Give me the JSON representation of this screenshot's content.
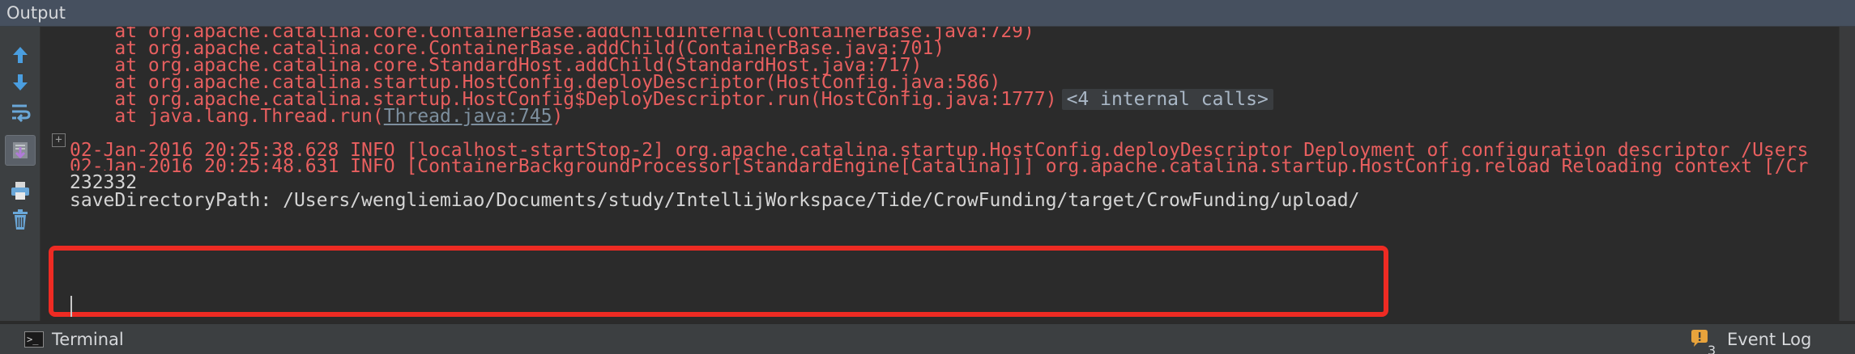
{
  "panel": {
    "title": "Output"
  },
  "console": {
    "lines": [
      {
        "kind": "err",
        "text": "    at org.apache.catalina.core.ContainerBase.addChildInternal(ContainerBase.java:729)"
      },
      {
        "kind": "err",
        "text": "    at org.apache.catalina.core.ContainerBase.addChild(ContainerBase.java:701)"
      },
      {
        "kind": "err",
        "text": "    at org.apache.catalina.core.StandardHost.addChild(StandardHost.java:717)"
      },
      {
        "kind": "err",
        "text": "    at org.apache.catalina.startup.HostConfig.deployDescriptor(HostConfig.java:586)"
      },
      {
        "kind": "err",
        "text": "    at org.apache.catalina.startup.HostConfig$DeployDescriptor.run(HostConfig.java:1777)"
      },
      {
        "kind": "err",
        "text": "    at java.lang.Thread.run("
      },
      {
        "kind": "err",
        "text": "02-Jan-2016 20:25:38.628 INFO [localhost-startStop-2] org.apache.catalina.startup.HostConfig.deployDescriptor Deployment of configuration descriptor /Users"
      },
      {
        "kind": "err",
        "text": "02-Jan-2016 20:25:48.631 INFO [ContainerBackgroundProcessor[StandardEngine[Catalina]]] org.apache.catalina.startup.HostConfig.reload Reloading context [/Cr"
      },
      {
        "kind": "out",
        "text": "232332"
      },
      {
        "kind": "out",
        "text": "saveDirectoryPath: /Users/wengliemiao/Documents/study/IntellijWorkspace/Tide/CrowFunding/target/CrowFunding/upload/"
      }
    ],
    "fold_label": "<4 internal calls>",
    "thread_link": "Thread.java:745",
    "thread_suffix": ")"
  },
  "statusbar": {
    "terminal_label": "Terminal",
    "terminal_icon_glyph": ">_",
    "event_log_label": "Event Log",
    "event_log_count": "3"
  },
  "icons": {
    "up": "arrow-up-icon",
    "down": "arrow-down-icon",
    "wrap": "soft-wrap-icon",
    "scroll_end": "scroll-to-end-icon",
    "print": "print-icon",
    "trash": "trash-icon"
  },
  "colors": {
    "accent_blue": "#4a9ee0",
    "error_text": "#e85f5f",
    "highlight_red": "#ee2b23"
  }
}
